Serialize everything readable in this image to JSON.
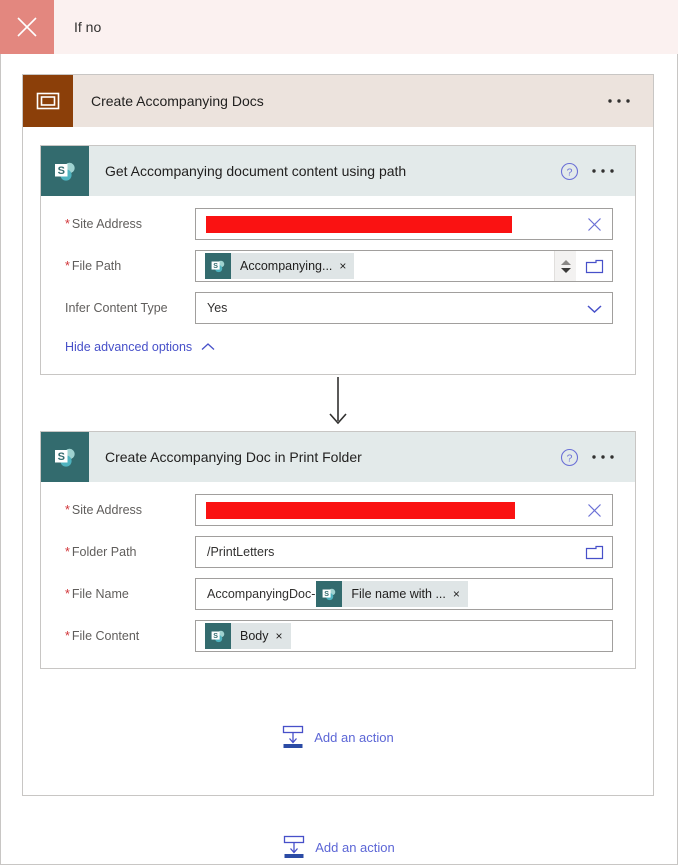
{
  "branch": {
    "title": "If no",
    "close_icon": "close-icon",
    "close_bg": "#e3877f",
    "header_bg": "#fbf1f0"
  },
  "scope": {
    "name": "Create Accompanying Docs",
    "icon": "scope-icon",
    "icon_bg": "#8b3f09",
    "header_bg": "#ece3dd",
    "menu_label": "• • •",
    "add_action": {
      "label": "Add an action",
      "icon": "insert-below-icon"
    }
  },
  "actions": [
    {
      "name": "Get Accompanying document content using path",
      "icon": "sharepoint-icon",
      "icon_bg": "#336b6e",
      "header_bg": "#e3eaea",
      "help_icon": "help-circle-icon",
      "menu_label": "• • •",
      "fields": [
        {
          "label": "Site Address",
          "required": true,
          "value_type": "redacted",
          "trailing_icon": "clear-x-icon"
        },
        {
          "label": "File Path",
          "required": true,
          "value_type": "token",
          "token": {
            "label": "Accompanying...",
            "icon": "sharepoint-icon",
            "remove": "×"
          },
          "trailing_icon": "spinner-and-folder-icon"
        },
        {
          "label": "Infer Content Type",
          "required": false,
          "value_type": "text",
          "value": "Yes",
          "trailing_icon": "chevron-down-icon"
        }
      ],
      "advanced_link": {
        "label": "Hide advanced options",
        "icon": "chevron-up-icon"
      }
    },
    {
      "name": "Create Accompanying Doc in Print Folder",
      "icon": "sharepoint-icon",
      "icon_bg": "#336b6e",
      "header_bg": "#e3eaea",
      "help_icon": "help-circle-icon",
      "menu_label": "• • •",
      "fields": [
        {
          "label": "Site Address",
          "required": true,
          "value_type": "redacted",
          "trailing_icon": "clear-x-icon"
        },
        {
          "label": "Folder Path",
          "required": true,
          "value_type": "text",
          "value": "/PrintLetters",
          "trailing_icon": "folder-icon"
        },
        {
          "label": "File Name",
          "required": true,
          "value_type": "prefix-token",
          "prefix": "AccompanyingDoc-",
          "token": {
            "label": "File name with ...",
            "icon": "sharepoint-icon",
            "remove": "×"
          },
          "trailing_icon": ""
        },
        {
          "label": "File Content",
          "required": true,
          "value_type": "token",
          "token": {
            "label": "Body",
            "icon": "sharepoint-icon",
            "remove": "×"
          },
          "trailing_icon": ""
        }
      ]
    }
  ],
  "outer_add_action": {
    "label": "Add an action",
    "icon": "insert-below-icon"
  },
  "colors": {
    "redaction": "#fa1212",
    "link": "#5c66d6",
    "required_asterisk": "#d13438",
    "sharepoint_teal": "#336b6e",
    "scope_brown": "#8b3f09"
  }
}
